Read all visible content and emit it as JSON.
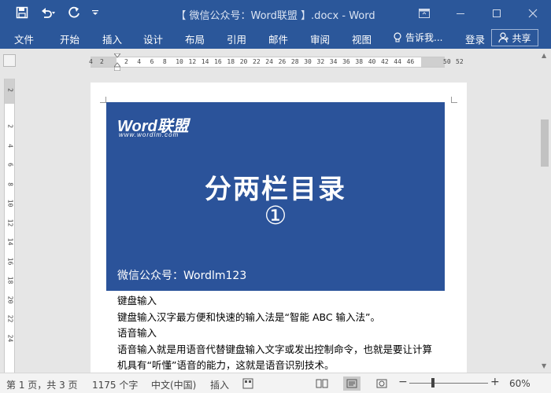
{
  "window": {
    "title": "【 微信公众号：Word联盟 】.docx - Word",
    "brand_color": "#2b579a"
  },
  "quick_access": [
    {
      "icon": "save-icon"
    },
    {
      "icon": "undo-icon"
    },
    {
      "icon": "redo-icon"
    },
    {
      "icon": "customize-qat-icon"
    }
  ],
  "ribbon": {
    "tabs": [
      "文件",
      "开始",
      "插入",
      "设计",
      "布局",
      "引用",
      "邮件",
      "审阅",
      "视图"
    ],
    "tell_me": "告诉我...",
    "sign_in": "登录",
    "share": "共享"
  },
  "ruler": {
    "horizontal": [
      "4",
      "2",
      "2",
      "4",
      "6",
      "8",
      "10",
      "12",
      "14",
      "16",
      "18",
      "20",
      "22",
      "24",
      "26",
      "28",
      "30",
      "32",
      "34",
      "36",
      "38",
      "40",
      "42",
      "44",
      "46",
      "50",
      "52"
    ],
    "vertical": [
      "2",
      "2",
      "4",
      "6",
      "8",
      "10",
      "12",
      "14",
      "16",
      "18",
      "20",
      "22",
      "24"
    ]
  },
  "document": {
    "banner": {
      "logo": "Word联盟",
      "logo_url": "www.wordlm.com",
      "title": "分两栏目录",
      "number": "①",
      "footer": "微信公众号：Wordlm123",
      "color": "#2b539a"
    },
    "paragraphs": [
      "键盘输入",
      "键盘输入汉字最方便和快速的输入法是“智能 ABC 输入法”。",
      "语音输入",
      "语音输入就是用语音代替键盘输入文字或发出控制命令，也就是要让计算",
      "机具有“听懂”语音的能力，这就是语音识别技术。"
    ]
  },
  "status": {
    "page": "第 1 页，共 3 页",
    "words": "1175 个字",
    "language": "中文(中国)",
    "mode": "插入",
    "zoom": "60%",
    "zoom_level": 0.6
  }
}
